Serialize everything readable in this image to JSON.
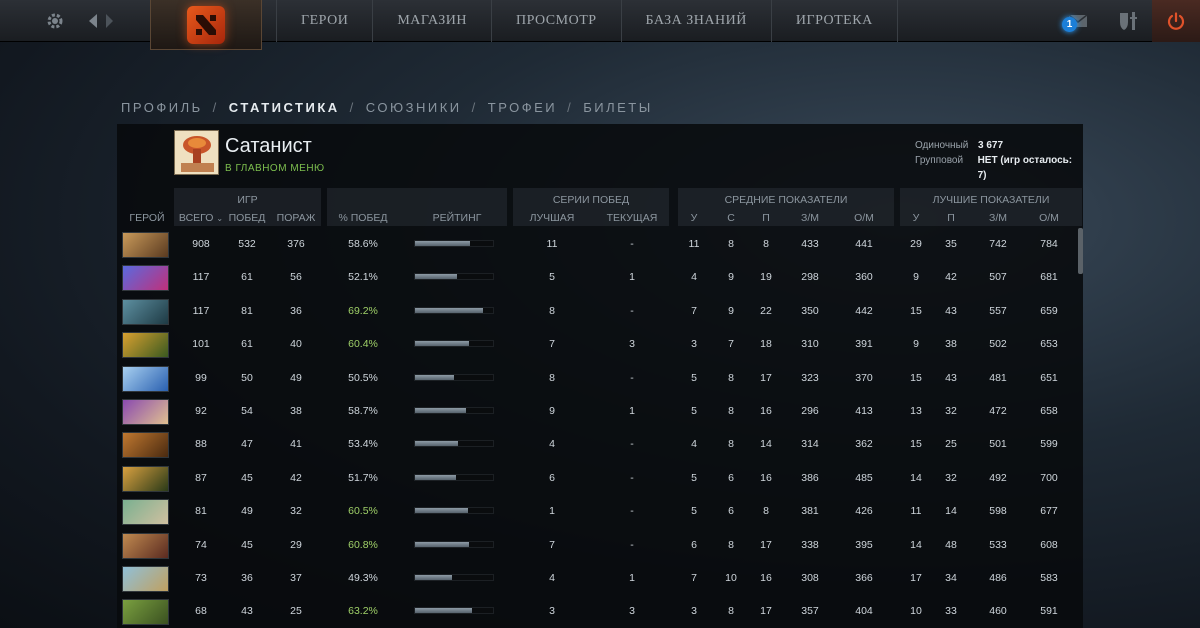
{
  "topbar": {
    "nav": [
      "ГЕРОИ",
      "МАГАЗИН",
      "ПРОСМОТР",
      "БАЗА ЗНАНИЙ",
      "ИГРОТЕКА"
    ],
    "mail_count": "1"
  },
  "breadcrumb": {
    "items": [
      "ПРОФИЛЬ",
      "СТАТИСТИКА",
      "СОЮЗНИКИ",
      "ТРОФЕИ",
      "БИЛЕТЫ"
    ],
    "separator": "/"
  },
  "profile": {
    "name": "Сатанист",
    "status": "В ГЛАВНОМ МЕНЮ",
    "solo_label": "Одиночный",
    "solo_value": "3 677",
    "party_label": "Групповой",
    "party_value": "НЕТ (игр осталось: 7)"
  },
  "table": {
    "groups": {
      "games": "ИГР",
      "streaks": "СЕРИИ ПОБЕД",
      "avg": "СРЕДНИЕ ПОКАЗАТЕЛИ",
      "best": "ЛУЧШИЕ ПОКАЗАТЕЛИ"
    },
    "headers": {
      "hero": "ГЕРОЙ",
      "total": "ВСЕГО",
      "wins": "ПОБЕД",
      "losses": "ПОРАЖ",
      "winrate": "% ПОБЕД",
      "rating": "РЕЙТИНГ",
      "best_streak": "ЛУЧШАЯ",
      "cur_streak": "ТЕКУЩАЯ",
      "avg_k": "У",
      "avg_d": "С",
      "avg_a": "П",
      "avg_gpm": "З/М",
      "avg_xpm": "О/М",
      "best_k": "У",
      "best_a": "П",
      "best_gpm": "З/М",
      "best_xpm": "О/М"
    },
    "rows": [
      {
        "total": "908",
        "wins": "532",
        "losses": "376",
        "winrate": "58.6%",
        "rating": 0.71,
        "best": "11",
        "cur": "-",
        "ak": "11",
        "ad": "8",
        "aa": "8",
        "agpm": "433",
        "axpm": "441",
        "bk": "29",
        "ba": "35",
        "bgpm": "742",
        "bxpm": "784",
        "hi": false,
        "hero_color": [
          "#c99a5a",
          "#5a3a20"
        ]
      },
      {
        "total": "117",
        "wins": "61",
        "losses": "56",
        "winrate": "52.1%",
        "rating": 0.54,
        "best": "5",
        "cur": "1",
        "ak": "4",
        "ad": "9",
        "aa": "19",
        "agpm": "298",
        "axpm": "360",
        "bk": "9",
        "ba": "42",
        "bgpm": "507",
        "bxpm": "681",
        "hi": false,
        "hero_color": [
          "#5a6adf",
          "#c0307a"
        ]
      },
      {
        "total": "117",
        "wins": "81",
        "losses": "36",
        "winrate": "69.2%",
        "rating": 0.87,
        "best": "8",
        "cur": "-",
        "ak": "7",
        "ad": "9",
        "aa": "22",
        "agpm": "350",
        "axpm": "442",
        "bk": "15",
        "ba": "43",
        "bgpm": "557",
        "bxpm": "659",
        "hi": true,
        "hero_color": [
          "#5d8fa0",
          "#1e3a44"
        ]
      },
      {
        "total": "101",
        "wins": "61",
        "losses": "40",
        "winrate": "60.4%",
        "rating": 0.69,
        "best": "7",
        "cur": "3",
        "ak": "3",
        "ad": "7",
        "aa": "18",
        "agpm": "310",
        "axpm": "391",
        "bk": "9",
        "ba": "38",
        "bgpm": "502",
        "bxpm": "653",
        "hi": true,
        "hero_color": [
          "#d9a030",
          "#3a5a20"
        ]
      },
      {
        "total": "99",
        "wins": "50",
        "losses": "49",
        "winrate": "50.5%",
        "rating": 0.5,
        "best": "8",
        "cur": "-",
        "ak": "5",
        "ad": "8",
        "aa": "17",
        "agpm": "323",
        "axpm": "370",
        "bk": "15",
        "ba": "43",
        "bgpm": "481",
        "bxpm": "651",
        "hi": false,
        "hero_color": [
          "#a8d0f0",
          "#2a60b0"
        ]
      },
      {
        "total": "92",
        "wins": "54",
        "losses": "38",
        "winrate": "58.7%",
        "rating": 0.66,
        "best": "9",
        "cur": "1",
        "ak": "5",
        "ad": "8",
        "aa": "16",
        "agpm": "296",
        "axpm": "413",
        "bk": "13",
        "ba": "32",
        "bgpm": "472",
        "bxpm": "658",
        "hi": false,
        "hero_color": [
          "#8a4ab0",
          "#e0c090"
        ]
      },
      {
        "total": "88",
        "wins": "47",
        "losses": "41",
        "winrate": "53.4%",
        "rating": 0.55,
        "best": "4",
        "cur": "-",
        "ak": "4",
        "ad": "8",
        "aa": "14",
        "agpm": "314",
        "axpm": "362",
        "bk": "15",
        "ba": "25",
        "bgpm": "501",
        "bxpm": "599",
        "hi": false,
        "hero_color": [
          "#c07830",
          "#4a2a10"
        ]
      },
      {
        "total": "87",
        "wins": "45",
        "losses": "42",
        "winrate": "51.7%",
        "rating": 0.52,
        "best": "6",
        "cur": "-",
        "ak": "5",
        "ad": "6",
        "aa": "16",
        "agpm": "386",
        "axpm": "485",
        "bk": "14",
        "ba": "32",
        "bgpm": "492",
        "bxpm": "700",
        "hi": false,
        "hero_color": [
          "#d8a040",
          "#2a3a18"
        ]
      },
      {
        "total": "81",
        "wins": "49",
        "losses": "32",
        "winrate": "60.5%",
        "rating": 0.68,
        "best": "1",
        "cur": "-",
        "ak": "5",
        "ad": "6",
        "aa": "8",
        "agpm": "381",
        "axpm": "426",
        "bk": "11",
        "ba": "14",
        "bgpm": "598",
        "bxpm": "677",
        "hi": true,
        "hero_color": [
          "#7ab090",
          "#d0c0a0"
        ]
      },
      {
        "total": "74",
        "wins": "45",
        "losses": "29",
        "winrate": "60.8%",
        "rating": 0.69,
        "best": "7",
        "cur": "-",
        "ak": "6",
        "ad": "8",
        "aa": "17",
        "agpm": "338",
        "axpm": "395",
        "bk": "14",
        "ba": "48",
        "bgpm": "533",
        "bxpm": "608",
        "hi": true,
        "hero_color": [
          "#c08a50",
          "#5a2a20"
        ]
      },
      {
        "total": "73",
        "wins": "36",
        "losses": "37",
        "winrate": "49.3%",
        "rating": 0.48,
        "best": "4",
        "cur": "1",
        "ak": "7",
        "ad": "10",
        "aa": "16",
        "agpm": "308",
        "axpm": "366",
        "bk": "17",
        "ba": "34",
        "bgpm": "486",
        "bxpm": "583",
        "hi": false,
        "hero_color": [
          "#90c0d8",
          "#c0a060"
        ]
      },
      {
        "total": "68",
        "wins": "43",
        "losses": "25",
        "winrate": "63.2%",
        "rating": 0.73,
        "best": "3",
        "cur": "3",
        "ak": "3",
        "ad": "8",
        "aa": "17",
        "agpm": "357",
        "axpm": "404",
        "bk": "10",
        "ba": "33",
        "bgpm": "460",
        "bxpm": "591",
        "hi": true,
        "hero_color": [
          "#7aa040",
          "#3a5020"
        ]
      }
    ]
  },
  "colors": {
    "winrate_high": "#9fd068",
    "status_green": "#7dbf4e",
    "mail_badge": "#1c7fd8",
    "power_icon": "#e0522a"
  },
  "icons": [
    "gear-icon",
    "back-arrow-icon",
    "forward-arrow-icon",
    "dota-logo-icon",
    "mail-icon",
    "armory-icon",
    "power-icon"
  ]
}
